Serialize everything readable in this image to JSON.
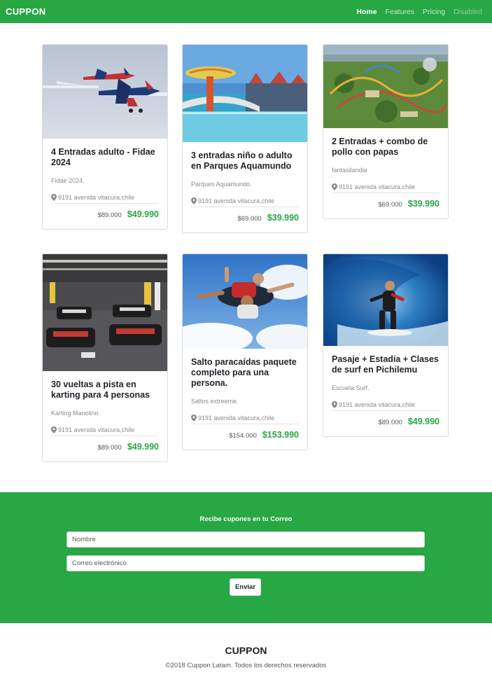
{
  "nav": {
    "brand": "CUPPON",
    "links": [
      {
        "label": "Home",
        "state": "active"
      },
      {
        "label": "Features",
        "state": "normal"
      },
      {
        "label": "Pricing",
        "state": "normal"
      },
      {
        "label": "Disabled",
        "state": "disabled"
      }
    ]
  },
  "deals": [
    {
      "title": "4 Entradas adulto - Fidae 2024",
      "subtitle": "Fidae 2024.",
      "location": "9191 avenida vitacura,chile",
      "old_price": "$89.000",
      "new_price": "$49.990",
      "image": "airshow-planes"
    },
    {
      "title": "3 entradas niño o adulto en Parques Aquamundo",
      "subtitle": "Parques Aquamundo.",
      "location": "9191 avenida vitacura,chile",
      "old_price": "$69.000",
      "new_price": "$39.990",
      "image": "water-park"
    },
    {
      "title": "2 Entradas + combo de pollo con papas",
      "subtitle": "fantasilandia",
      "location": "9191 avenida vitacura,chile",
      "old_price": "$69.000",
      "new_price": "$39.990",
      "image": "amusement-park-aerial"
    },
    {
      "title": "30 vueltas a pista en karting para 4 personas",
      "subtitle": "Karting Manolino.",
      "location": "9191 avenida vitacura,chile",
      "old_price": "$89.000",
      "new_price": "$49.990",
      "image": "go-karts"
    },
    {
      "title": "Salto paracaídas paquete completo para una persona.",
      "subtitle": "Saltos extreeme.",
      "location": "9191 avenida vitacura,chile",
      "old_price": "$154.000",
      "new_price": "$153.990",
      "image": "skydiving"
    },
    {
      "title": "Pasaje + Estadía + Clases de surf en Pichilemu",
      "subtitle": "Escuela Surf.",
      "location": "9191 avenida vitacura,chile",
      "old_price": "$89.000",
      "new_price": "$49.990",
      "image": "surfer-wave"
    }
  ],
  "subscribe": {
    "title": "Recibe cupones en tu Correo",
    "name_placeholder": "Nombre",
    "email_placeholder": "Correo electrónico",
    "button": "Enviar"
  },
  "footer": {
    "brand": "CUPPON",
    "copyright": "©2018 Cuppon Latam. Todos los derechos reservados"
  },
  "colors": {
    "accent": "#28a745"
  }
}
